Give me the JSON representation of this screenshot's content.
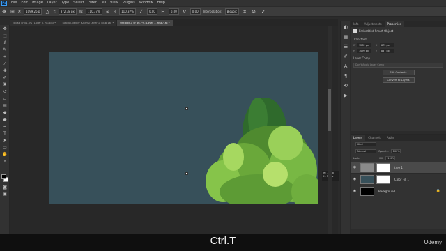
{
  "app": {
    "logo": "Ps"
  },
  "menu": [
    "File",
    "Edit",
    "Image",
    "Layer",
    "Type",
    "Select",
    "Filter",
    "3D",
    "View",
    "Plugins",
    "Window",
    "Help"
  ],
  "options": {
    "x_label": "X:",
    "x_value": "1099.25 p",
    "y_label": "Y:",
    "y_value": "872.38 px",
    "w_label": "W:",
    "w_value": "110.37%",
    "h_label": "H:",
    "h_value": "110.37%",
    "angle_value": "0.00",
    "h_skew_value": "0.00",
    "v_skew_value": "0.00",
    "interp_label": "Interpolation:",
    "interp_value": "Bicubic"
  },
  "tabs": [
    {
      "label": "5.psb @ 51.3% (Layer 0, RGB/8) *"
    },
    {
      "label": "Tutorial.psd @ 62.8% (Layer 1, RGB/16) *"
    },
    {
      "label": "Untitled-1 @ 66.7% (Layer 1, RGB/16) *"
    }
  ],
  "readout": {
    "w": "W: 36 px",
    "h": "H: 32 px"
  },
  "properties": {
    "tabs": [
      "Info",
      "Adjustments",
      "Properties"
    ],
    "active_tab": "Properties",
    "subtitle": "Embedded Smart Object",
    "transform_label": "Transform",
    "w_value": "1282 px",
    "x_value": "872 px",
    "h_value": "1099 px",
    "y_value": "837 px",
    "layer_comp_label": "Layer Comp",
    "layer_comp_value": "Don't Apply Layer Comp",
    "edit_btn": "Edit Contents",
    "convert_btn": "Convert to Layers"
  },
  "layers": {
    "tabs": [
      "Layers",
      "Channels",
      "Paths"
    ],
    "active_tab": "Layers",
    "kind_label": "Kind",
    "blend_mode": "Normal",
    "opacity_label": "Opacity:",
    "opacity_value": "100%",
    "lock_label": "Lock:",
    "fill_label": "Fill:",
    "fill_value": "100%",
    "rows": [
      {
        "name": "tree 1",
        "selected": true
      },
      {
        "name": "Color Fill 1",
        "selected": false
      },
      {
        "name": "Background",
        "selected": false
      }
    ]
  },
  "caption": "Ctrl.T",
  "watermark": "Udemy",
  "colors": {
    "canvas": "#37505a",
    "selection_box": "#5b8fb5",
    "panel_bg": "#323232",
    "app_bg": "#282828"
  },
  "icons": [
    "move-icon",
    "marquee-icon",
    "lasso-icon",
    "quick-select-icon",
    "crop-icon",
    "eyedropper-icon",
    "healing-icon",
    "brush-icon",
    "clone-stamp-icon",
    "history-brush-icon",
    "eraser-icon",
    "gradient-icon",
    "blur-icon",
    "dodge-icon",
    "pen-icon",
    "type-icon",
    "path-select-icon",
    "rectangle-icon",
    "hand-icon",
    "zoom-icon"
  ]
}
